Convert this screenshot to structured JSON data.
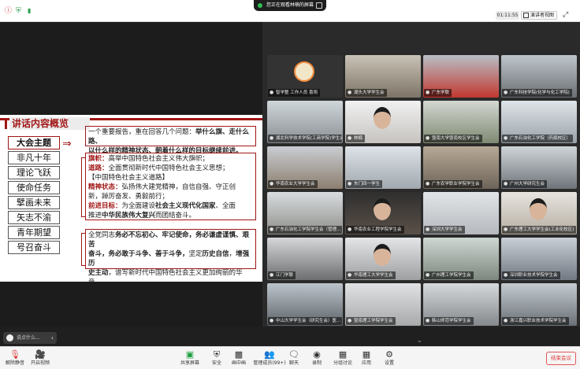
{
  "topbar": {
    "share_label": "您正在观看林楠的屏幕",
    "timer": "01:11:55",
    "view_label": "演讲者视图",
    "fullscreen_icon": "expand-icon",
    "icons": [
      "info-icon",
      "shield-icon",
      "signal-icon"
    ]
  },
  "slide": {
    "title": "讲话内容概览",
    "nav": [
      "大会主题",
      "非凡十年",
      "理论飞跃",
      "使命任务",
      "擘画未来",
      "矢志不渝",
      "青年期望",
      "号召奋斗"
    ],
    "box1": {
      "line1_a": "一个重要报告，重在回答几个问题：",
      "line1_b": "举什么旗、走什么路、",
      "line2": "以什么样的精神状态、朝着什么样的目标继续前进。"
    },
    "box2": {
      "l1_key": "旗帜：",
      "l1_val": "高举中国特色社会主义伟大旗帜；",
      "l2_key": "道路：",
      "l2_val": "全面贯彻新时代中国特色社会主义思想；",
      "l3": "【中国特色社会主义道路】",
      "l4_key": "精神状态：",
      "l4_val": "弘扬伟大建党精神，自信自强、守正创",
      "l5": "新，踔厉奋发、勇毅前行；",
      "l6_key": "前进目标：",
      "l6_val_a": "为全面建设",
      "l6_val_b": "社会主义现代化国家",
      "l6_val_c": "、全面",
      "l7_a": "推进",
      "l7_b": "中华民族伟大复兴",
      "l7_c": "而团结奋斗。"
    },
    "box3": {
      "l1_a": "全党同志",
      "l1_b": "务必不忘初心、牢记使命，务必谦虚谨慎、艰苦",
      "l2_b": "奋斗，务必敢于斗争、善于斗争，",
      "l2_c": "坚定",
      "l2_d": "历史自信",
      "l2_e": "，",
      "l2_f": "增强历",
      "l3_a": "史主动",
      "l3_b": "，谱写新时代中国特色社会主义更加绚丽的华章。"
    }
  },
  "chat": {
    "label": "说点什么..."
  },
  "gallery": {
    "tiles": [
      "智学整 工作人员 喜闹",
      "湖头大学学生会",
      "广东学联",
      "广东科技学院(化学与化工学院)",
      "湖北科学技术学院(工商学院)学生会",
      "林楠",
      "暨南大学暨南校区学生会",
      "广东石油化工学院（药瓶校区）",
      "华南农业大学学生会",
      "东门四一学生",
      "广东农学职业学院学生会",
      "广州大学研究生会",
      "广东石油化工学院学生会（管理...",
      "华南农业工程学院学生会",
      "深圳大学学生会",
      "广东理工大学学生会(工业化校区)",
      "江门学联",
      "华南理工大学学生会",
      "广州理工学院学生会",
      "深圳职业技术学院学生会",
      "中山大学学生会（研究生会）医...",
      "暨南理工学院学生会",
      "韩山师范学院学生会",
      "浙江嘉兴职业技术学院学生会"
    ],
    "page_down_icon": "chevron-down-icon"
  },
  "bottombar": {
    "mute": "解除静音",
    "video": "开启视频",
    "share": "共享屏幕",
    "security": "安全",
    "pip": "画中画",
    "participants": "管理成员(99+)",
    "chat": "聊天",
    "record": "录制",
    "breakout": "分组讨论",
    "apps": "应用",
    "settings": "设置",
    "end": "结束会议"
  },
  "colors": {
    "accent_red": "#a11616",
    "share_green": "#1e9e3e",
    "end_red": "#e03131"
  }
}
